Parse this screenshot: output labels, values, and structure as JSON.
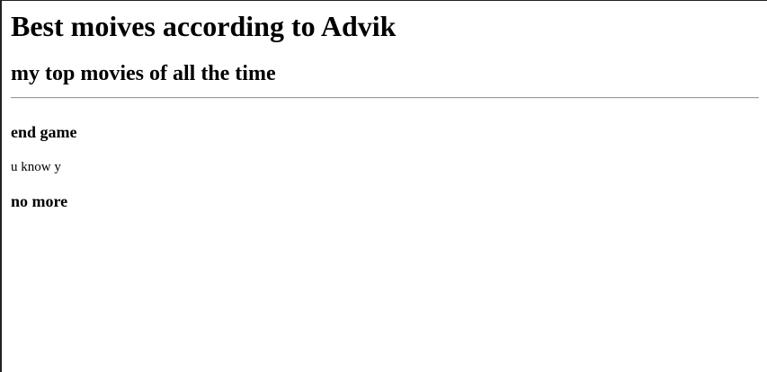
{
  "page": {
    "heading": "Best moives according to Advik",
    "subheading": "my top movies of all the time",
    "movies": [
      {
        "title": "end game",
        "description": "u know y"
      },
      {
        "title": "no more"
      }
    ]
  },
  "colors": {
    "background": "#ffffff",
    "text": "#000000",
    "divider": "#9a9a9a"
  }
}
